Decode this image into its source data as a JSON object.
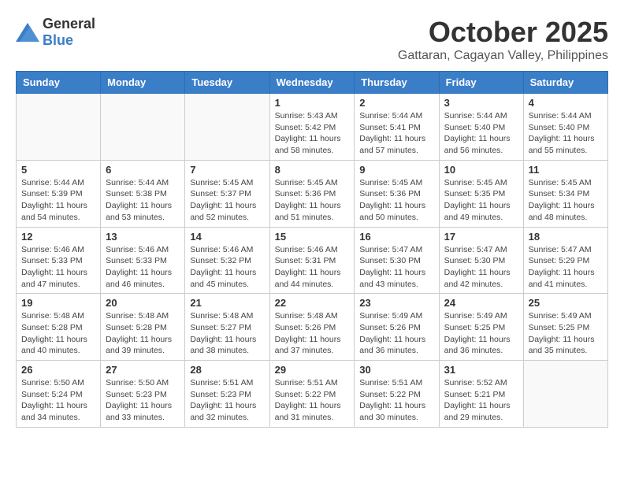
{
  "logo": {
    "general": "General",
    "blue": "Blue"
  },
  "title": "October 2025",
  "location": "Gattaran, Cagayan Valley, Philippines",
  "days_of_week": [
    "Sunday",
    "Monday",
    "Tuesday",
    "Wednesday",
    "Thursday",
    "Friday",
    "Saturday"
  ],
  "weeks": [
    [
      {
        "day": "",
        "sunrise": "",
        "sunset": "",
        "daylight": ""
      },
      {
        "day": "",
        "sunrise": "",
        "sunset": "",
        "daylight": ""
      },
      {
        "day": "",
        "sunrise": "",
        "sunset": "",
        "daylight": ""
      },
      {
        "day": "1",
        "sunrise": "Sunrise: 5:43 AM",
        "sunset": "Sunset: 5:42 PM",
        "daylight": "Daylight: 11 hours and 58 minutes."
      },
      {
        "day": "2",
        "sunrise": "Sunrise: 5:44 AM",
        "sunset": "Sunset: 5:41 PM",
        "daylight": "Daylight: 11 hours and 57 minutes."
      },
      {
        "day": "3",
        "sunrise": "Sunrise: 5:44 AM",
        "sunset": "Sunset: 5:40 PM",
        "daylight": "Daylight: 11 hours and 56 minutes."
      },
      {
        "day": "4",
        "sunrise": "Sunrise: 5:44 AM",
        "sunset": "Sunset: 5:40 PM",
        "daylight": "Daylight: 11 hours and 55 minutes."
      }
    ],
    [
      {
        "day": "5",
        "sunrise": "Sunrise: 5:44 AM",
        "sunset": "Sunset: 5:39 PM",
        "daylight": "Daylight: 11 hours and 54 minutes."
      },
      {
        "day": "6",
        "sunrise": "Sunrise: 5:44 AM",
        "sunset": "Sunset: 5:38 PM",
        "daylight": "Daylight: 11 hours and 53 minutes."
      },
      {
        "day": "7",
        "sunrise": "Sunrise: 5:45 AM",
        "sunset": "Sunset: 5:37 PM",
        "daylight": "Daylight: 11 hours and 52 minutes."
      },
      {
        "day": "8",
        "sunrise": "Sunrise: 5:45 AM",
        "sunset": "Sunset: 5:36 PM",
        "daylight": "Daylight: 11 hours and 51 minutes."
      },
      {
        "day": "9",
        "sunrise": "Sunrise: 5:45 AM",
        "sunset": "Sunset: 5:36 PM",
        "daylight": "Daylight: 11 hours and 50 minutes."
      },
      {
        "day": "10",
        "sunrise": "Sunrise: 5:45 AM",
        "sunset": "Sunset: 5:35 PM",
        "daylight": "Daylight: 11 hours and 49 minutes."
      },
      {
        "day": "11",
        "sunrise": "Sunrise: 5:45 AM",
        "sunset": "Sunset: 5:34 PM",
        "daylight": "Daylight: 11 hours and 48 minutes."
      }
    ],
    [
      {
        "day": "12",
        "sunrise": "Sunrise: 5:46 AM",
        "sunset": "Sunset: 5:33 PM",
        "daylight": "Daylight: 11 hours and 47 minutes."
      },
      {
        "day": "13",
        "sunrise": "Sunrise: 5:46 AM",
        "sunset": "Sunset: 5:33 PM",
        "daylight": "Daylight: 11 hours and 46 minutes."
      },
      {
        "day": "14",
        "sunrise": "Sunrise: 5:46 AM",
        "sunset": "Sunset: 5:32 PM",
        "daylight": "Daylight: 11 hours and 45 minutes."
      },
      {
        "day": "15",
        "sunrise": "Sunrise: 5:46 AM",
        "sunset": "Sunset: 5:31 PM",
        "daylight": "Daylight: 11 hours and 44 minutes."
      },
      {
        "day": "16",
        "sunrise": "Sunrise: 5:47 AM",
        "sunset": "Sunset: 5:30 PM",
        "daylight": "Daylight: 11 hours and 43 minutes."
      },
      {
        "day": "17",
        "sunrise": "Sunrise: 5:47 AM",
        "sunset": "Sunset: 5:30 PM",
        "daylight": "Daylight: 11 hours and 42 minutes."
      },
      {
        "day": "18",
        "sunrise": "Sunrise: 5:47 AM",
        "sunset": "Sunset: 5:29 PM",
        "daylight": "Daylight: 11 hours and 41 minutes."
      }
    ],
    [
      {
        "day": "19",
        "sunrise": "Sunrise: 5:48 AM",
        "sunset": "Sunset: 5:28 PM",
        "daylight": "Daylight: 11 hours and 40 minutes."
      },
      {
        "day": "20",
        "sunrise": "Sunrise: 5:48 AM",
        "sunset": "Sunset: 5:28 PM",
        "daylight": "Daylight: 11 hours and 39 minutes."
      },
      {
        "day": "21",
        "sunrise": "Sunrise: 5:48 AM",
        "sunset": "Sunset: 5:27 PM",
        "daylight": "Daylight: 11 hours and 38 minutes."
      },
      {
        "day": "22",
        "sunrise": "Sunrise: 5:48 AM",
        "sunset": "Sunset: 5:26 PM",
        "daylight": "Daylight: 11 hours and 37 minutes."
      },
      {
        "day": "23",
        "sunrise": "Sunrise: 5:49 AM",
        "sunset": "Sunset: 5:26 PM",
        "daylight": "Daylight: 11 hours and 36 minutes."
      },
      {
        "day": "24",
        "sunrise": "Sunrise: 5:49 AM",
        "sunset": "Sunset: 5:25 PM",
        "daylight": "Daylight: 11 hours and 36 minutes."
      },
      {
        "day": "25",
        "sunrise": "Sunrise: 5:49 AM",
        "sunset": "Sunset: 5:25 PM",
        "daylight": "Daylight: 11 hours and 35 minutes."
      }
    ],
    [
      {
        "day": "26",
        "sunrise": "Sunrise: 5:50 AM",
        "sunset": "Sunset: 5:24 PM",
        "daylight": "Daylight: 11 hours and 34 minutes."
      },
      {
        "day": "27",
        "sunrise": "Sunrise: 5:50 AM",
        "sunset": "Sunset: 5:23 PM",
        "daylight": "Daylight: 11 hours and 33 minutes."
      },
      {
        "day": "28",
        "sunrise": "Sunrise: 5:51 AM",
        "sunset": "Sunset: 5:23 PM",
        "daylight": "Daylight: 11 hours and 32 minutes."
      },
      {
        "day": "29",
        "sunrise": "Sunrise: 5:51 AM",
        "sunset": "Sunset: 5:22 PM",
        "daylight": "Daylight: 11 hours and 31 minutes."
      },
      {
        "day": "30",
        "sunrise": "Sunrise: 5:51 AM",
        "sunset": "Sunset: 5:22 PM",
        "daylight": "Daylight: 11 hours and 30 minutes."
      },
      {
        "day": "31",
        "sunrise": "Sunrise: 5:52 AM",
        "sunset": "Sunset: 5:21 PM",
        "daylight": "Daylight: 11 hours and 29 minutes."
      },
      {
        "day": "",
        "sunrise": "",
        "sunset": "",
        "daylight": ""
      }
    ]
  ]
}
